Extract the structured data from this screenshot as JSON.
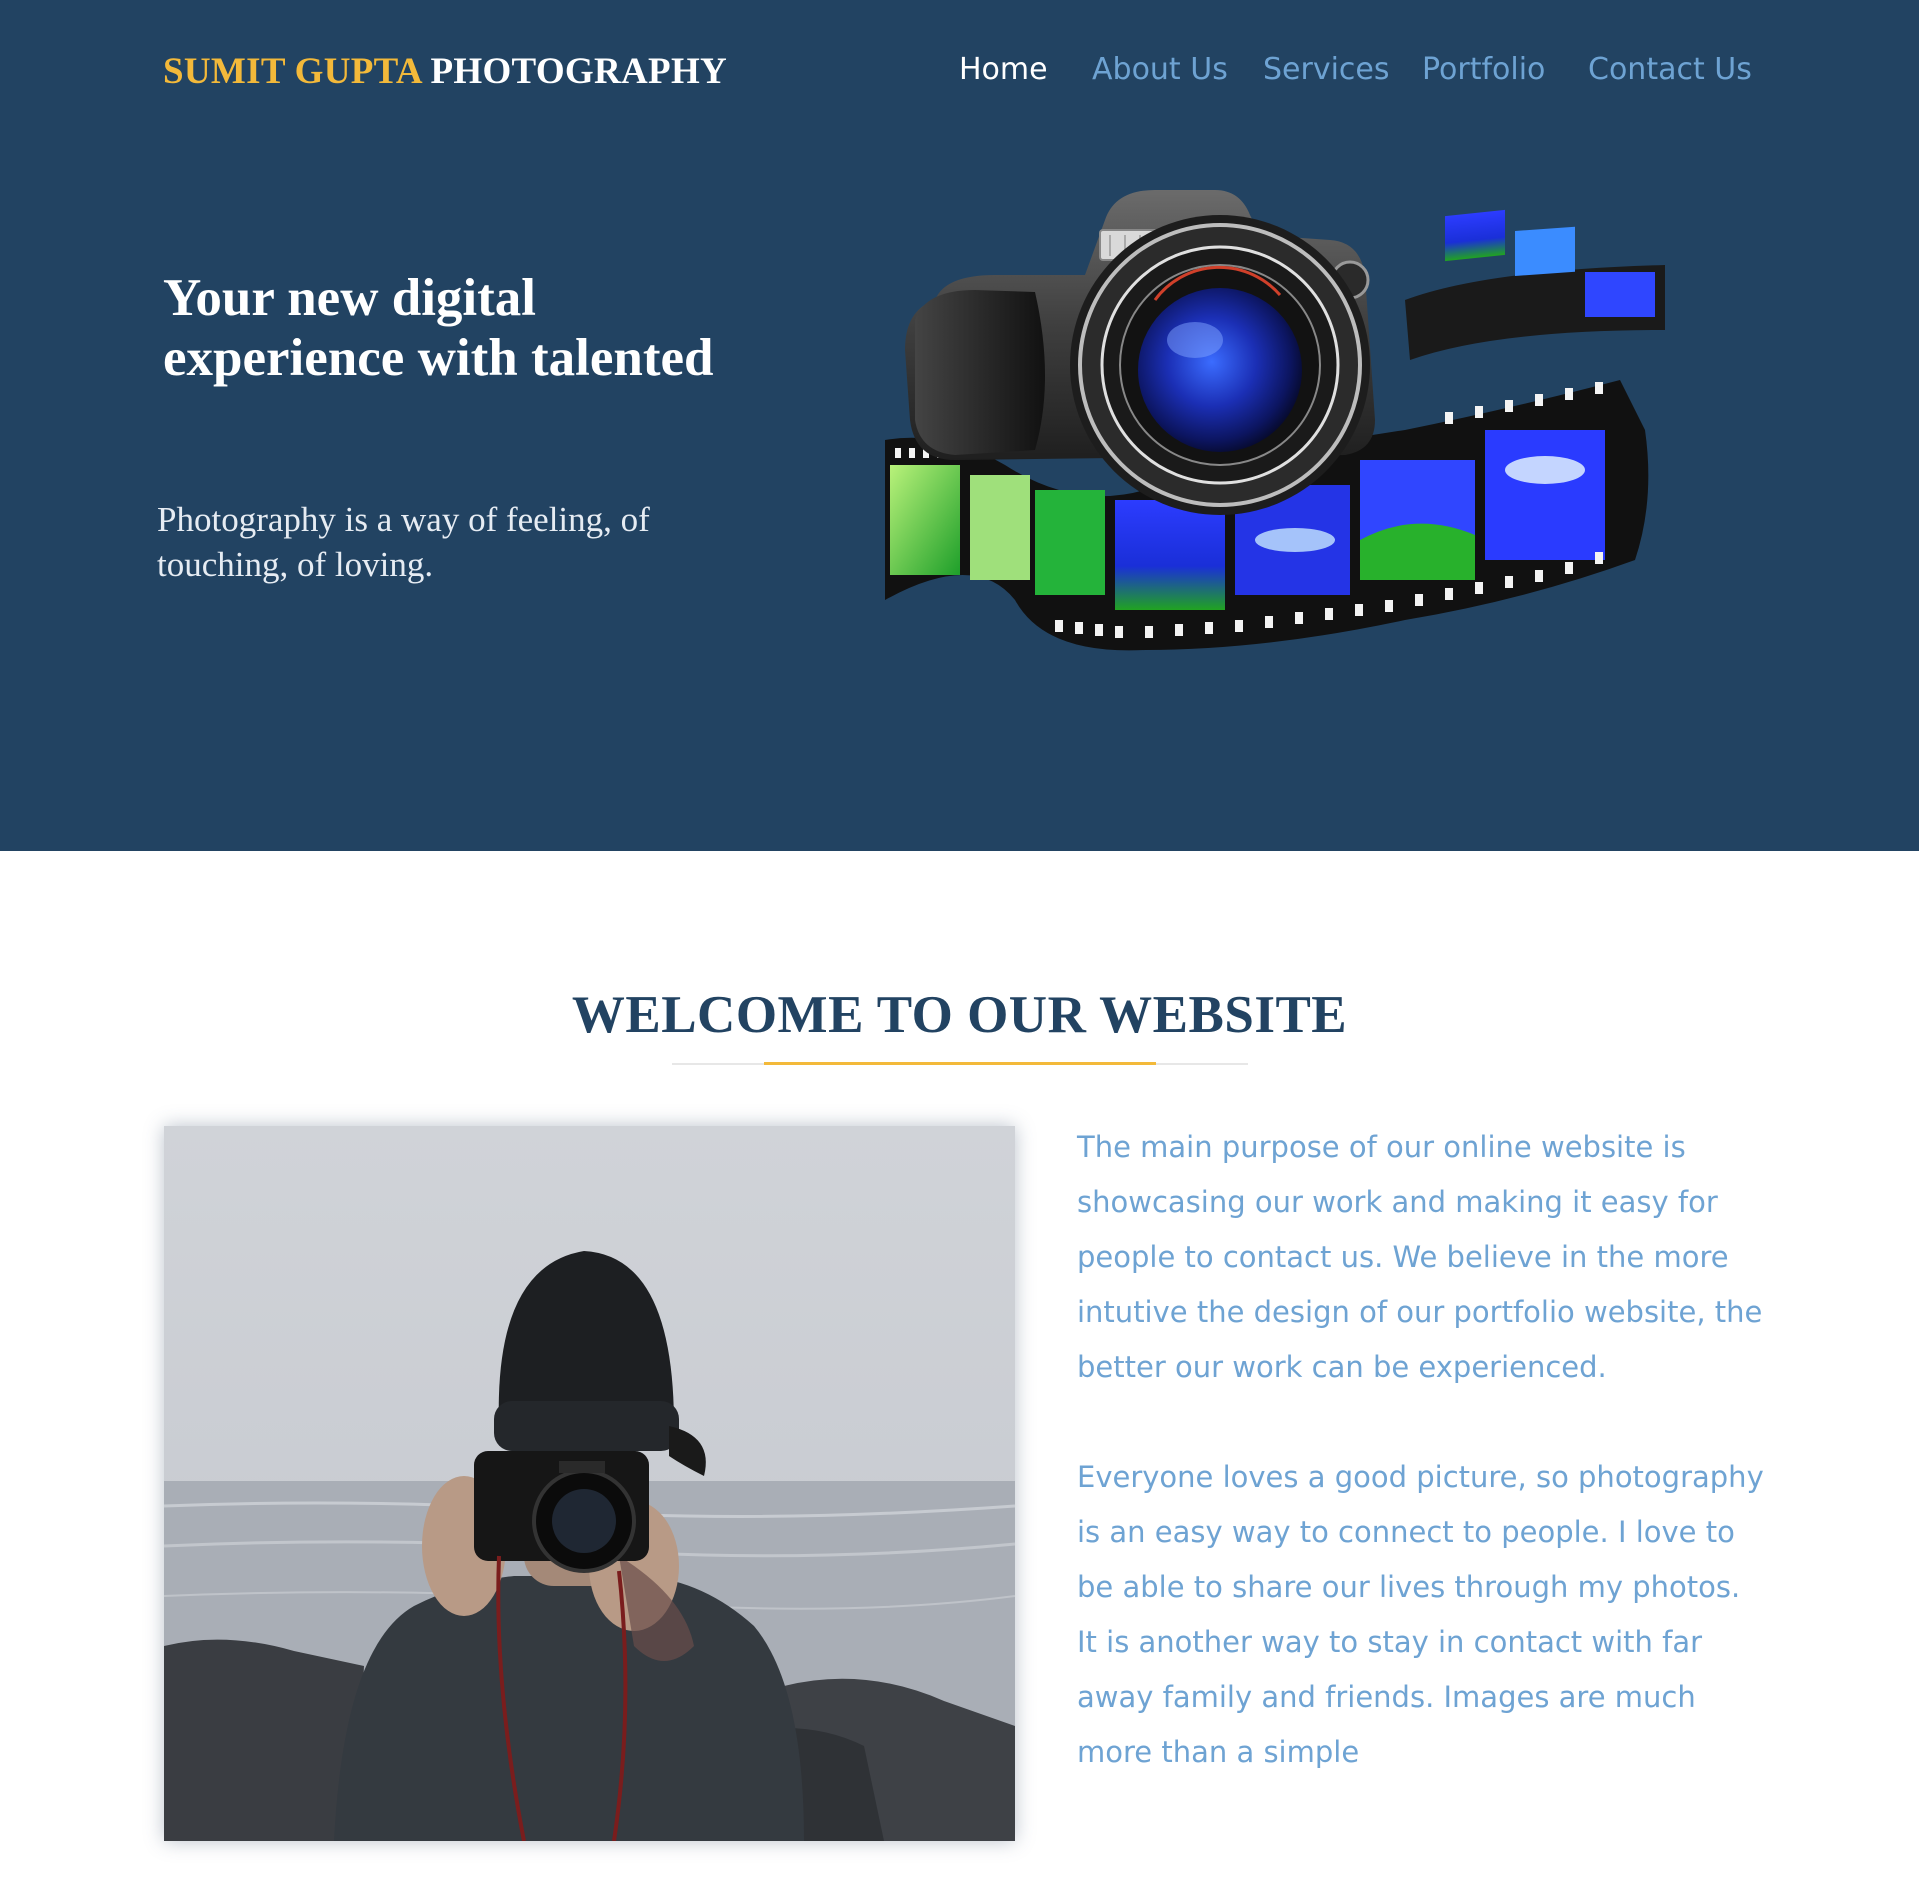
{
  "header": {
    "brand_first": "SUMIT GUPTA",
    "brand_second": "PHOTOGRAPHY",
    "nav": [
      "Home",
      "About Us",
      "Services",
      "Portfolio",
      "Contact Us"
    ],
    "active_nav": "Home"
  },
  "hero": {
    "title": "Your new digital experience with talented",
    "subtitle": "Photography is a way of feeling, of touching, of loving.",
    "illustration": "camera-with-film-strip-illustration"
  },
  "welcome": {
    "title": "WELCOME TO OUR WEBSITE",
    "photo": "photographer-with-camera-at-seashore",
    "paragraphs": [
      "The main purpose of our online website is showcasing our work and making it easy for people to contact us. We believe in the more intutive the design of our portfolio website, the better our work can be experienced.",
      "Everyone loves a good picture, so photography is an easy way to connect to people. I love to be able to share our lives through my photos. It is another way to stay in contact with far away family and friends. Images are much more than a simple"
    ]
  },
  "colors": {
    "navy": "#224362",
    "gold": "#f3b93a",
    "link_blue": "#6ea3d3",
    "white": "#ffffff"
  }
}
